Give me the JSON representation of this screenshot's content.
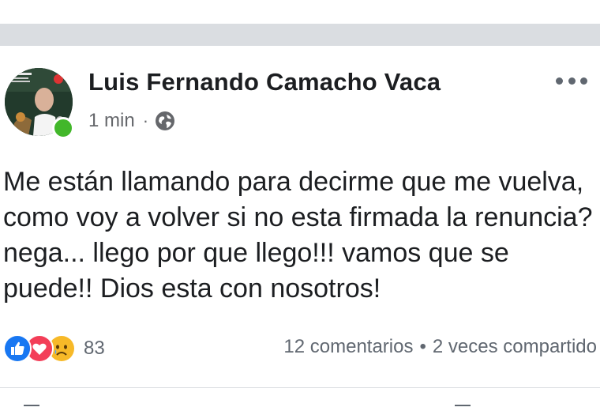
{
  "post": {
    "author_name": "Luis Fernando Camacho Vaca",
    "timestamp": "1 min",
    "separator": "·",
    "privacy_icon": "globe-icon",
    "more_icon": "more-options-icon",
    "text": "Me están llamando para decirme que me vuelva, como voy a volver si no esta firmada la renuncia? nega... llego por que llego!!! vamos que se puede!! Dios esta con nosotros!",
    "online_status_color": "#42b72a"
  },
  "reactions": {
    "icons": [
      "like-reaction-icon",
      "love-reaction-icon",
      "sad-reaction-icon"
    ],
    "count": "83"
  },
  "stats": {
    "comments": "12 comentarios",
    "separator": "•",
    "shares": "2 veces compartido"
  },
  "colors": {
    "text_primary": "#1c1e21",
    "text_secondary": "#65676b",
    "like_blue": "#1877f2",
    "love_red": "#f33e58",
    "sad_yellow": "#f7b928",
    "divider": "#dadde1"
  }
}
